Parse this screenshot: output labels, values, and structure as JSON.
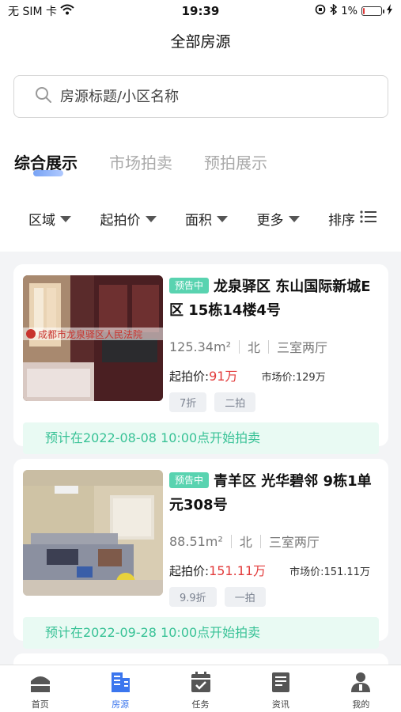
{
  "status_bar": {
    "carrier": "无 SIM 卡",
    "time": "19:39",
    "battery_text": "1%",
    "battery_level": 0.01
  },
  "header": {
    "title": "全部房源"
  },
  "search": {
    "placeholder": "房源标题/小区名称"
  },
  "tabs": [
    {
      "label": "综合展示",
      "active": true
    },
    {
      "label": "市场拍卖",
      "active": false
    },
    {
      "label": "预拍展示",
      "active": false
    }
  ],
  "filters": [
    {
      "label": "区域"
    },
    {
      "label": "起拍价"
    },
    {
      "label": "面积"
    },
    {
      "label": "更多"
    },
    {
      "label": "排序"
    }
  ],
  "listings": [
    {
      "badge": "预告中",
      "title": "龙泉驿区 东山国际新城E区 15栋14楼4号",
      "area": "125.34m²",
      "orientation": "北",
      "layout": "三室两厅",
      "price_label": "起拍价:",
      "price": "91万",
      "market_label": "市场价:",
      "market_price": "129万",
      "tags": [
        "7折",
        "二拍"
      ],
      "photo_caption": "成都市龙泉驿区人民法院",
      "notice": "预计在2022-08-08 10:00点开始拍卖"
    },
    {
      "badge": "预告中",
      "title": "青羊区 光华碧邻 9栋1单元308号",
      "area": "88.51m²",
      "orientation": "北",
      "layout": "三室两厅",
      "price_label": "起拍价:",
      "price": "151.11万",
      "market_label": "市场价:",
      "market_price": "151.11万",
      "tags": [
        "9.9折",
        "一拍"
      ],
      "notice": "预计在2022-09-28 10:00点开始拍卖"
    }
  ],
  "tab_bar": [
    {
      "label": "首页",
      "icon": "home-icon",
      "active": false
    },
    {
      "label": "房源",
      "icon": "building-icon",
      "active": true
    },
    {
      "label": "任务",
      "icon": "calendar-check-icon",
      "active": false
    },
    {
      "label": "资讯",
      "icon": "news-icon",
      "active": false
    },
    {
      "label": "我的",
      "icon": "user-icon",
      "active": false
    }
  ],
  "colors": {
    "accent": "#3b76ee",
    "badge": "#59d3b0",
    "price": "#e23b3b",
    "notice_text": "#38c296",
    "notice_bg": "#e9faf3"
  }
}
